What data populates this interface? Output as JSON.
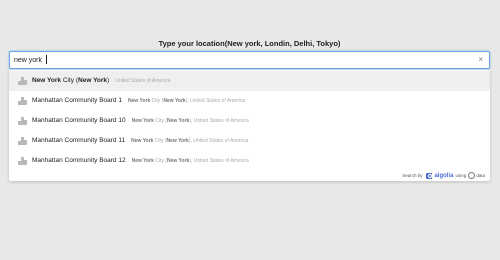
{
  "prompt_label": "Type your location(New york, Londin, Delhi, Tokyo)",
  "search": {
    "value": "new york",
    "clear_icon": "×"
  },
  "results": [
    {
      "icon": "building-icon",
      "primary_parts": [
        {
          "text": "New York",
          "highlight": true
        },
        {
          "text": " City (",
          "highlight": false
        },
        {
          "text": "New York",
          "highlight": true
        },
        {
          "text": ")",
          "highlight": false
        }
      ],
      "secondary_parts": [
        {
          "text": "United States of America",
          "highlight": false
        }
      ]
    },
    {
      "icon": "building-icon",
      "primary_parts": [
        {
          "text": "Manhattan Community Board 1",
          "highlight": false
        }
      ],
      "secondary_parts": [
        {
          "text": "New York",
          "highlight": true
        },
        {
          "text": " City (",
          "highlight": false
        },
        {
          "text": "New York",
          "highlight": true
        },
        {
          "text": "), United States of America",
          "highlight": false
        }
      ]
    },
    {
      "icon": "building-icon",
      "primary_parts": [
        {
          "text": "Manhattan Community Board 10",
          "highlight": false
        }
      ],
      "secondary_parts": [
        {
          "text": "New York",
          "highlight": true
        },
        {
          "text": " City (",
          "highlight": false
        },
        {
          "text": "New York",
          "highlight": true
        },
        {
          "text": "), United States of America",
          "highlight": false
        }
      ]
    },
    {
      "icon": "building-icon",
      "primary_parts": [
        {
          "text": "Manhattan Community Board 11",
          "highlight": false
        }
      ],
      "secondary_parts": [
        {
          "text": "New York",
          "highlight": true
        },
        {
          "text": " City (",
          "highlight": false
        },
        {
          "text": "New York",
          "highlight": true
        },
        {
          "text": "), United States of America",
          "highlight": false
        }
      ]
    },
    {
      "icon": "building-icon",
      "primary_parts": [
        {
          "text": "Manhattan Community Board 12",
          "highlight": false
        }
      ],
      "secondary_parts": [
        {
          "text": "New York",
          "highlight": true
        },
        {
          "text": " City (",
          "highlight": false
        },
        {
          "text": "New York",
          "highlight": true
        },
        {
          "text": "), United States of America",
          "highlight": false
        }
      ]
    }
  ],
  "footer": {
    "search_by": "Search by",
    "brand": "algolia",
    "using": "using",
    "data": "data"
  },
  "colors": {
    "accent": "#4e6fd6",
    "focus_border": "#6aa7e8",
    "active_row": "#efefef"
  }
}
